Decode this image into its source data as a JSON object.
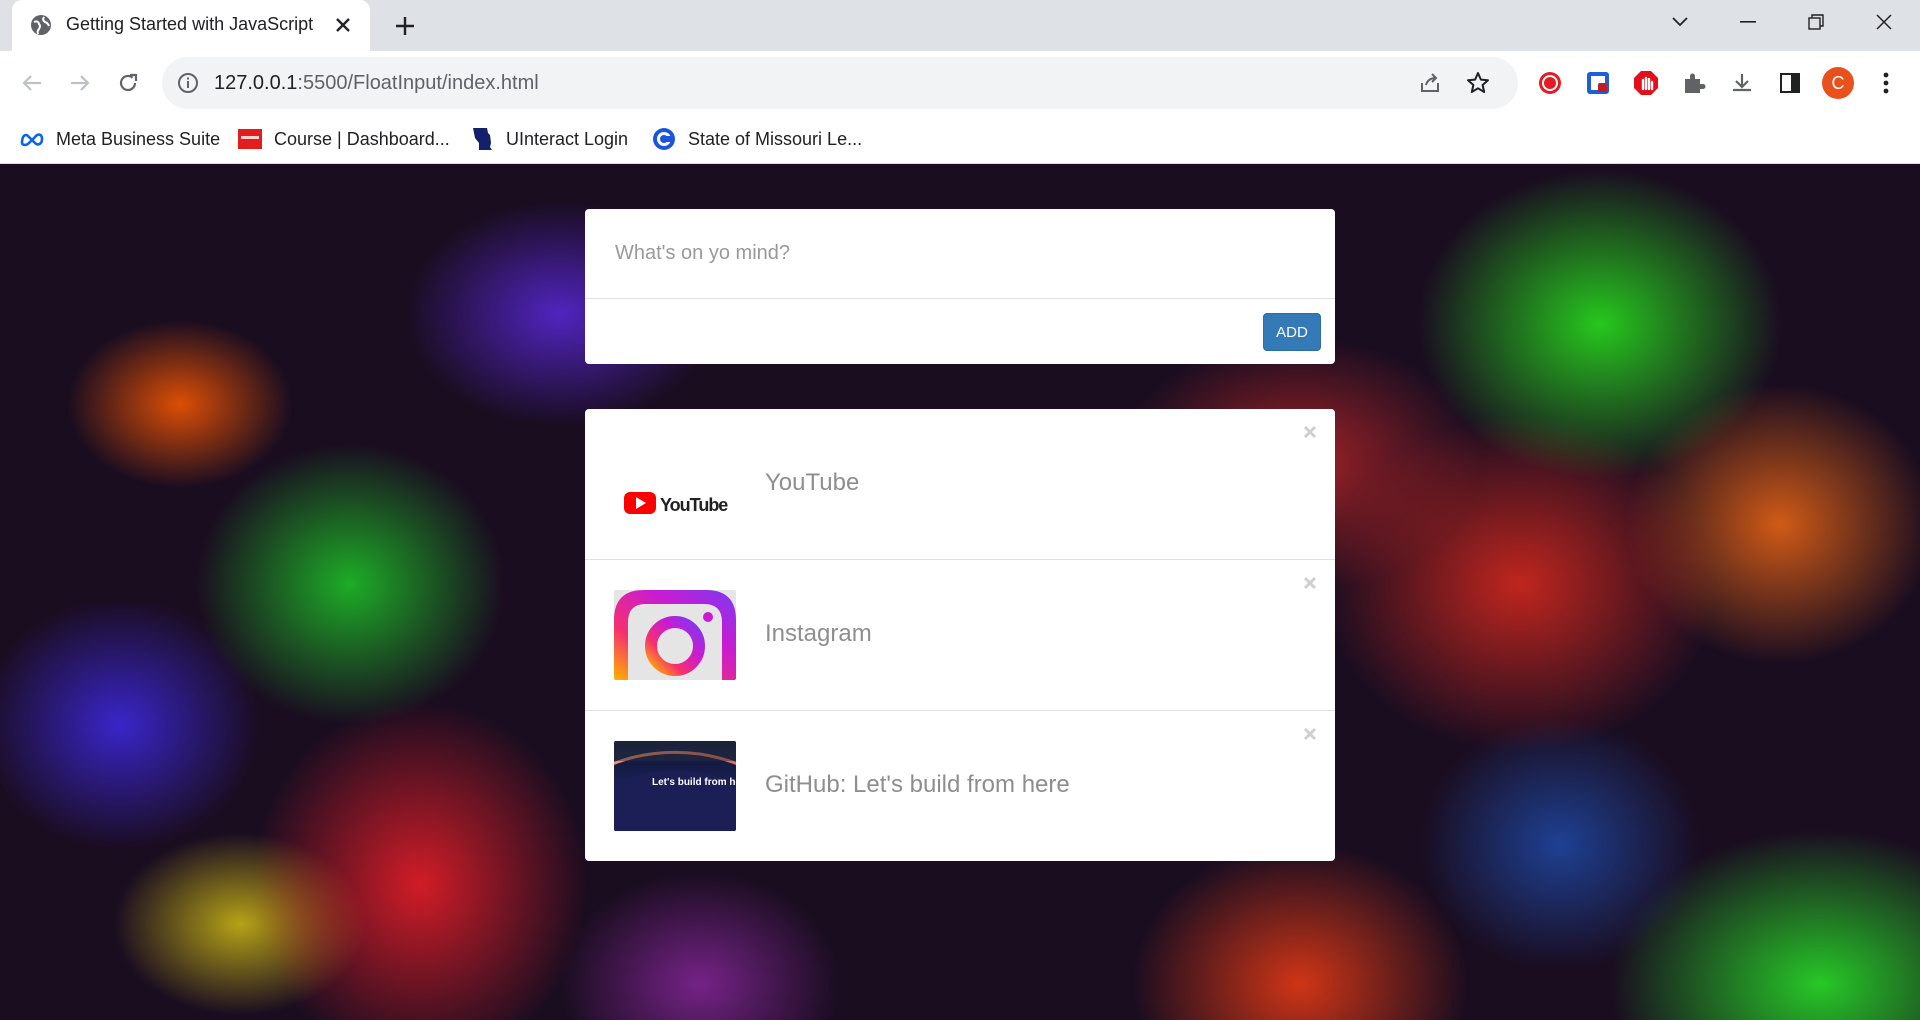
{
  "browser": {
    "tab": {
      "title": "Getting Started with JavaScript",
      "favicon": "globe-icon"
    },
    "url": {
      "host": "127.0.0.1",
      "port_and_path": ":5500/FloatInput/index.html"
    },
    "profile_initial": "C",
    "profile_color": "#e8501c"
  },
  "bookmarks": [
    {
      "label": "Meta Business Suite",
      "icon": "meta-icon"
    },
    {
      "label": "Course | Dashboard...",
      "icon": "course-icon"
    },
    {
      "label": "UInteract Login",
      "icon": "missouri-icon"
    },
    {
      "label": "State of Missouri Le...",
      "icon": "circle-c-icon"
    }
  ],
  "composer": {
    "placeholder": "What's on yo mind?",
    "value": "",
    "add_label": "ADD",
    "add_color": "#337ab7"
  },
  "items": [
    {
      "label": "YouTube",
      "thumb": "youtube-logo"
    },
    {
      "label": "Instagram",
      "thumb": "instagram-logo"
    },
    {
      "label": "GitHub: Let's build from here",
      "thumb": "github-banner",
      "thumb_text": "Let's build from he"
    }
  ]
}
